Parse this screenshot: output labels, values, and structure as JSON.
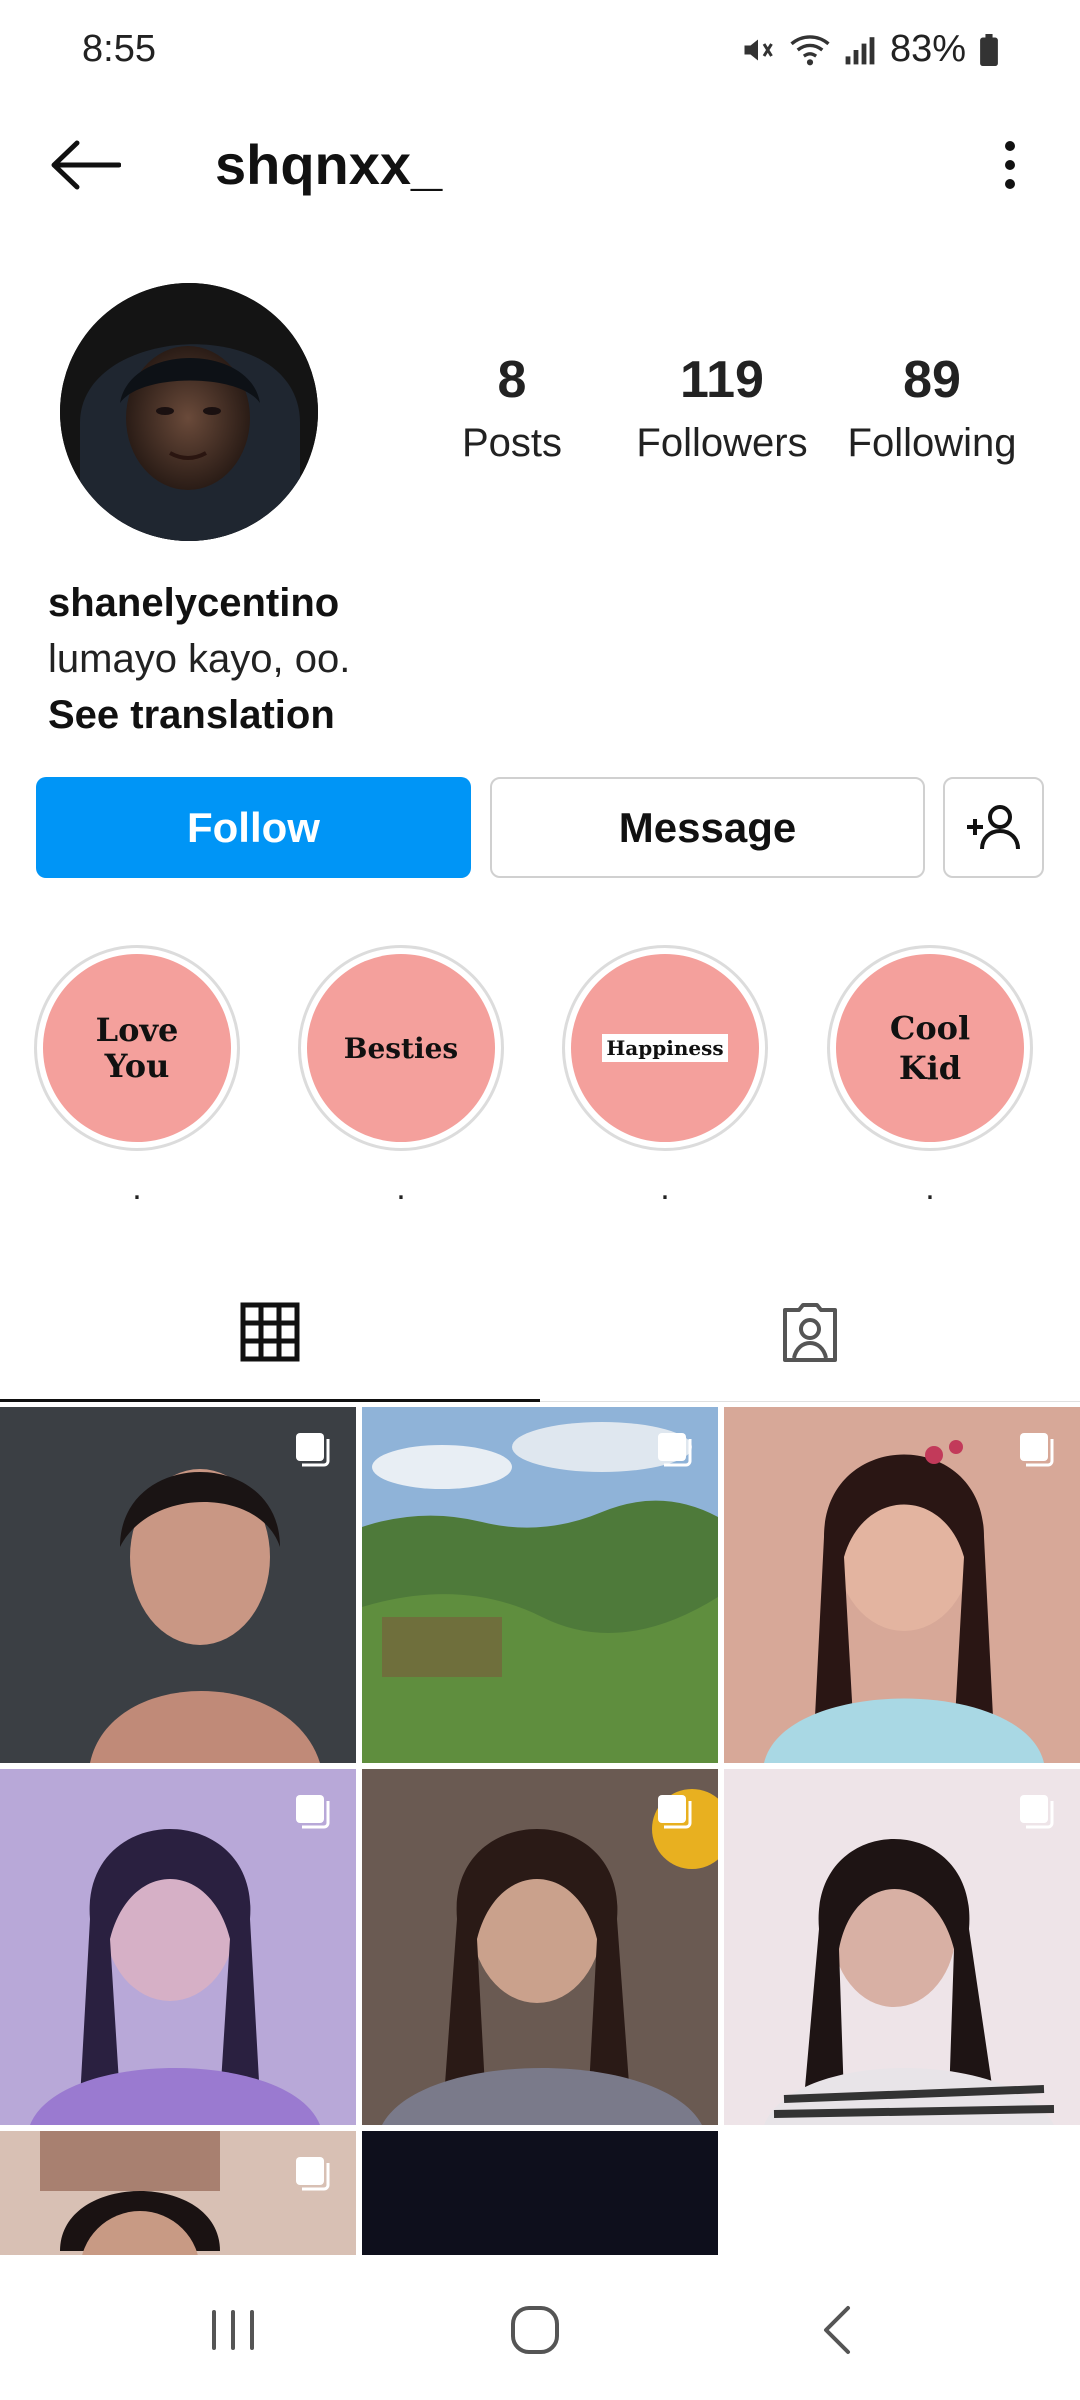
{
  "status_bar": {
    "time": "8:55",
    "battery": "83%",
    "icons": [
      "mute-icon",
      "wifi-icon",
      "signal-icon",
      "battery-icon"
    ]
  },
  "header": {
    "username": "shqnxx_",
    "back_icon": "arrow-left-icon",
    "more_icon": "more-vertical-icon"
  },
  "profile": {
    "stats": [
      {
        "value": "8",
        "label": "Posts"
      },
      {
        "value": "119",
        "label": "Followers"
      },
      {
        "value": "89",
        "label": "Following"
      }
    ],
    "name": "shanelycentino",
    "bio": "lumayo kayo, oo.",
    "translate_label": "See translation"
  },
  "actions": {
    "follow_label": "Follow",
    "message_label": "Message",
    "add_user_icon": "add-user-icon"
  },
  "highlights": [
    {
      "art": [
        "Love",
        "You"
      ],
      "label": "."
    },
    {
      "art": [
        "Besties"
      ],
      "label": "."
    },
    {
      "art": [
        "Happiness"
      ],
      "label": "."
    },
    {
      "art": [
        "Cool",
        "Kid"
      ],
      "label": "."
    }
  ],
  "tabs": [
    {
      "name": "posts-grid",
      "icon": "grid-icon"
    },
    {
      "name": "tagged",
      "icon": "tagged-person-icon"
    }
  ],
  "colors": {
    "follow_blue": "#0095f6",
    "highlight_pink": "#f4a09c"
  },
  "nav_bar": {
    "icons": [
      "recent-apps-icon",
      "home-icon",
      "back-nav-icon"
    ]
  }
}
